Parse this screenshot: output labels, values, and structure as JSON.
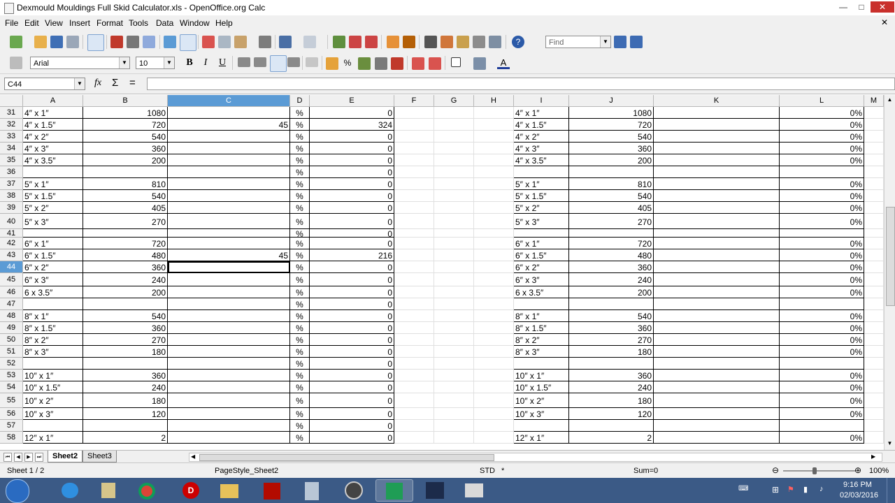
{
  "window": {
    "title": "Dexmould Mouldings Full Skid Calculator.xls - OpenOffice.org Calc",
    "minimize": "—",
    "maximize": "□",
    "close": "✕"
  },
  "menu": [
    "File",
    "Edit",
    "View",
    "Insert",
    "Format",
    "Tools",
    "Data",
    "Window",
    "Help"
  ],
  "toolbar": {
    "find_placeholder": "Find",
    "font_name": "Arial",
    "font_size": "10",
    "bold": "B",
    "italic": "I",
    "underline": "U",
    "percent": "%",
    "font_color_glyph": "A"
  },
  "formula_bar": {
    "name_box": "C44",
    "function_wizard": "fx",
    "sum": "Σ",
    "equals": "=",
    "value": ""
  },
  "columns": [
    "A",
    "B",
    "C",
    "D",
    "E",
    "F",
    "G",
    "H",
    "I",
    "J",
    "K",
    "L",
    "M"
  ],
  "selected_column": "C",
  "selected_row": "44",
  "rows": [
    {
      "n": "31",
      "a": "4″ x 1″",
      "b": "1080",
      "c": "",
      "d": "%",
      "e": "0",
      "i": "4″ x 1″",
      "j": "1080",
      "l": "0%"
    },
    {
      "n": "32",
      "a": "4″ x 1.5″",
      "b": "720",
      "c": "45",
      "d": "%",
      "e": "324",
      "i": "4″ x 1.5″",
      "j": "720",
      "l": "0%"
    },
    {
      "n": "33",
      "a": "4″ x 2″",
      "b": "540",
      "c": "",
      "d": "%",
      "e": "0",
      "i": "4″ x 2″",
      "j": "540",
      "l": "0%"
    },
    {
      "n": "34",
      "a": "4″ x 3″",
      "b": "360",
      "c": "",
      "d": "%",
      "e": "0",
      "i": "4″ x 3″",
      "j": "360",
      "l": "0%"
    },
    {
      "n": "35",
      "a": "4″ x 3.5″",
      "b": "200",
      "c": "",
      "d": "%",
      "e": "0",
      "i": "4″ x 3.5″",
      "j": "200",
      "l": "0%"
    },
    {
      "n": "36",
      "a": "",
      "b": "",
      "c": "",
      "d": "%",
      "e": "0",
      "i": "",
      "j": "",
      "l": ""
    },
    {
      "n": "37",
      "a": "5″ x 1″",
      "b": "810",
      "c": "",
      "d": "%",
      "e": "0",
      "i": "5″ x 1″",
      "j": "810",
      "l": "0%"
    },
    {
      "n": "38",
      "a": "5″ x 1.5″",
      "b": "540",
      "c": "",
      "d": "%",
      "e": "0",
      "i": "5″ x 1.5″",
      "j": "540",
      "l": "0%"
    },
    {
      "n": "39",
      "a": "5″ x 2″",
      "b": "405",
      "c": "",
      "d": "%",
      "e": "0",
      "i": "5″ x 2″",
      "j": "405",
      "l": "0%"
    },
    {
      "n": "40",
      "a": "5″ x 3″",
      "b": "270",
      "c": "",
      "d": "%",
      "e": "0",
      "i": "5″ x 3″",
      "j": "270",
      "l": "0%"
    },
    {
      "n": "41",
      "a": "",
      "b": "",
      "c": "",
      "d": "%",
      "e": "0",
      "i": "",
      "j": "",
      "l": ""
    },
    {
      "n": "42",
      "a": "6″ x 1″",
      "b": "720",
      "c": "",
      "d": "%",
      "e": "0",
      "i": "6″ x 1″",
      "j": "720",
      "l": "0%"
    },
    {
      "n": "43",
      "a": "6″ x 1.5″",
      "b": "480",
      "c": "45",
      "d": "%",
      "e": "216",
      "i": "6″ x 1.5″",
      "j": "480",
      "l": "0%"
    },
    {
      "n": "44",
      "a": "6″ x 2″",
      "b": "360",
      "c": "",
      "d": "%",
      "e": "0",
      "i": "6″ x 2″",
      "j": "360",
      "l": "0%"
    },
    {
      "n": "45",
      "a": "6″ x 3″",
      "b": "240",
      "c": "",
      "d": "%",
      "e": "0",
      "i": "6″ x 3″",
      "j": "240",
      "l": "0%"
    },
    {
      "n": "46",
      "a": "6 x 3.5″",
      "b": "200",
      "c": "",
      "d": "%",
      "e": "0",
      "i": "6 x 3.5″",
      "j": "200",
      "l": "0%"
    },
    {
      "n": "47",
      "a": "",
      "b": "",
      "c": "",
      "d": "%",
      "e": "0",
      "i": "",
      "j": "",
      "l": ""
    },
    {
      "n": "48",
      "a": "8″ x 1″",
      "b": "540",
      "c": "",
      "d": "%",
      "e": "0",
      "i": "8″ x 1″",
      "j": "540",
      "l": "0%"
    },
    {
      "n": "49",
      "a": "8″ x 1.5″",
      "b": "360",
      "c": "",
      "d": "%",
      "e": "0",
      "i": "8″ x 1.5″",
      "j": "360",
      "l": "0%"
    },
    {
      "n": "50",
      "a": "8″ x 2″",
      "b": "270",
      "c": "",
      "d": "%",
      "e": "0",
      "i": "8″ x 2″",
      "j": "270",
      "l": "0%"
    },
    {
      "n": "51",
      "a": "8″ x 3″",
      "b": "180",
      "c": "",
      "d": "%",
      "e": "0",
      "i": "8″ x 3″",
      "j": "180",
      "l": "0%"
    },
    {
      "n": "52",
      "a": "",
      "b": "",
      "c": "",
      "d": "%",
      "e": "0",
      "i": "",
      "j": "",
      "l": ""
    },
    {
      "n": "53",
      "a": "10″ x 1″",
      "b": "360",
      "c": "",
      "d": "%",
      "e": "0",
      "i": "10″ x 1″",
      "j": "360",
      "l": "0%"
    },
    {
      "n": "54",
      "a": "10″ x 1.5″",
      "b": "240",
      "c": "",
      "d": "%",
      "e": "0",
      "i": "10″ x 1.5″",
      "j": "240",
      "l": "0%"
    },
    {
      "n": "55",
      "a": "10″ x 2″",
      "b": "180",
      "c": "",
      "d": "%",
      "e": "0",
      "i": "10″ x 2″",
      "j": "180",
      "l": "0%"
    },
    {
      "n": "56",
      "a": "10″ x 3″",
      "b": "120",
      "c": "",
      "d": "%",
      "e": "0",
      "i": "10″ x 3″",
      "j": "120",
      "l": "0%"
    },
    {
      "n": "57",
      "a": "",
      "b": "",
      "c": "",
      "d": "%",
      "e": "0",
      "i": "",
      "j": "",
      "l": ""
    },
    {
      "n": "58",
      "a": "12″ x 1″",
      "b": "2",
      "c": "",
      "d": "%",
      "e": "0",
      "i": "12″ x 1″",
      "j": "2",
      "l": "0%"
    }
  ],
  "sheet_tabs": [
    "Sheet2",
    "Sheet3"
  ],
  "active_sheet": "Sheet2",
  "status": {
    "sheet": "Sheet 1 / 2",
    "page_style": "PageStyle_Sheet2",
    "mode": "STD",
    "modified": "*",
    "sum": "Sum=0",
    "zoom": "100%"
  },
  "taskbar": {
    "time": "9:16 PM",
    "date": "02/03/2016",
    "apps": [
      "start-orb",
      "internet-explorer",
      "file-cabinet",
      "chrome",
      "dexmould",
      "acrobat",
      "calculator",
      "vlc",
      "calc-app",
      "media-player",
      "folders"
    ]
  }
}
